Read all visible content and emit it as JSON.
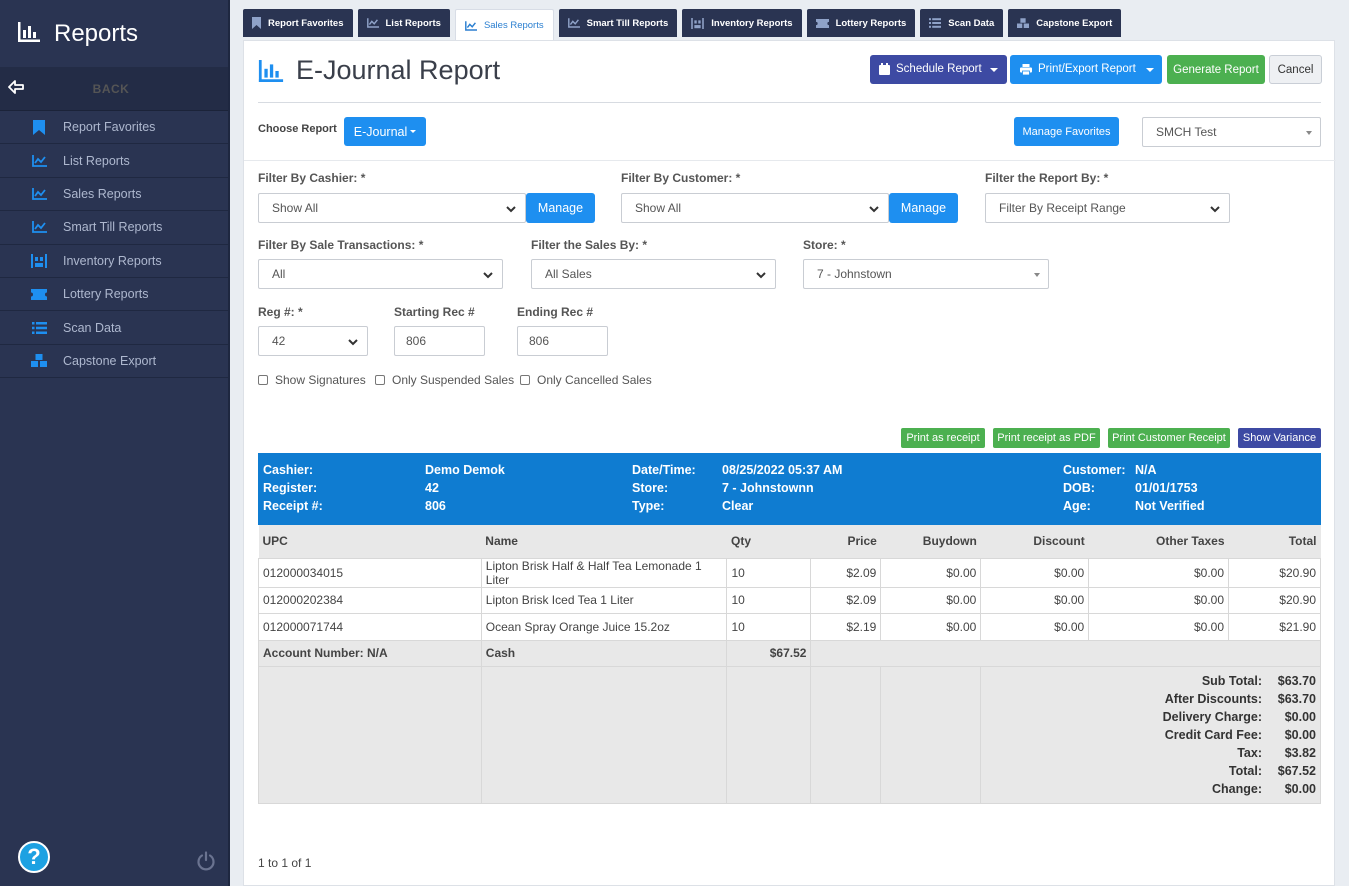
{
  "sidebar": {
    "title": "Reports",
    "back_label": "BACK",
    "items": [
      {
        "label": "Report Favorites"
      },
      {
        "label": "List Reports"
      },
      {
        "label": "Sales Reports"
      },
      {
        "label": "Smart Till Reports"
      },
      {
        "label": "Inventory Reports"
      },
      {
        "label": "Lottery Reports"
      },
      {
        "label": "Scan Data"
      },
      {
        "label": "Capstone Export"
      }
    ],
    "help_label": "?"
  },
  "tabs": [
    {
      "label": "Report Favorites"
    },
    {
      "label": "List Reports"
    },
    {
      "label": "Sales Reports",
      "active": true
    },
    {
      "label": "Smart Till Reports"
    },
    {
      "label": "Inventory Reports"
    },
    {
      "label": "Lottery Reports"
    },
    {
      "label": "Scan Data"
    },
    {
      "label": "Capstone Export"
    }
  ],
  "page": {
    "title": "E-Journal Report",
    "schedule_label": "Schedule Report",
    "print_label": "Print/Export Report",
    "generate_label": "Generate Report",
    "cancel_label": "Cancel",
    "choose_report_label": "Choose Report",
    "choose_report_value": "E-Journal",
    "manage_favorites_label": "Manage Favorites",
    "favorite_value": "SMCH Test"
  },
  "filters": {
    "cashier_label": "Filter By Cashier: *",
    "cashier_value": "Show All",
    "customer_label": "Filter By Customer: *",
    "customer_value": "Show All",
    "manage_label": "Manage",
    "report_by_label": "Filter the Report By: *",
    "report_by_value": "Filter By Receipt Range",
    "sale_trans_label": "Filter By Sale Transactions: *",
    "sale_trans_value": "All",
    "sales_by_label": "Filter the Sales By: *",
    "sales_by_value": "All Sales",
    "store_label": "Store: *",
    "store_value": "7 - Johnstown",
    "reg_label": "Reg #: *",
    "reg_value": "42",
    "start_label": "Starting Rec #",
    "start_value": "806",
    "end_label": "Ending Rec #",
    "end_value": "806",
    "show_signatures": "Show Signatures",
    "only_suspended": "Only Suspended Sales",
    "only_cancelled": "Only Cancelled Sales"
  },
  "actions": {
    "print_receipt": "Print as receipt",
    "print_pdf": "Print receipt as PDF",
    "print_customer": "Print Customer Receipt",
    "show_variance": "Show Variance"
  },
  "receipt": {
    "cashier_k": "Cashier:",
    "cashier_v": "Demo Demok",
    "register_k": "Register:",
    "register_v": "42",
    "receipt_k": "Receipt #:",
    "receipt_v": "806",
    "datetime_k": "Date/Time:",
    "datetime_v": "08/25/2022 05:37 AM",
    "store_k": "Store:",
    "store_v": "7 - Johnstownn",
    "type_k": "Type:",
    "type_v": "Clear",
    "customer_k": "Customer:",
    "customer_v": "N/A",
    "dob_k": "DOB:",
    "dob_v": "01/01/1753",
    "age_k": "Age:",
    "age_v": "Not Verified"
  },
  "table": {
    "headers": [
      "UPC",
      "Name",
      "Qty",
      "Price",
      "Buydown",
      "Discount",
      "Other Taxes",
      "Total"
    ],
    "rows": [
      [
        "012000034015",
        "Lipton Brisk Half & Half Tea Lemonade 1 Liter",
        "10",
        "$2.09",
        "$0.00",
        "$0.00",
        "$0.00",
        "$20.90"
      ],
      [
        "012000202384",
        "Lipton Brisk Iced Tea 1 Liter",
        "10",
        "$2.09",
        "$0.00",
        "$0.00",
        "$0.00",
        "$20.90"
      ],
      [
        "012000071744",
        "Ocean Spray Orange Juice 15.2oz",
        "10",
        "$2.19",
        "$0.00",
        "$0.00",
        "$0.00",
        "$21.90"
      ]
    ],
    "account_number": "Account Number: N/A",
    "payment_type": "Cash",
    "payment_amount": "$67.52",
    "totals": [
      {
        "k": "Sub Total:",
        "v": "$63.70"
      },
      {
        "k": "After Discounts:",
        "v": "$63.70"
      },
      {
        "k": "Delivery Charge:",
        "v": "$0.00"
      },
      {
        "k": "Credit Card Fee:",
        "v": "$0.00"
      },
      {
        "k": "Tax:",
        "v": "$3.82"
      },
      {
        "k": "Total:",
        "v": "$67.52"
      },
      {
        "k": "Change:",
        "v": "$0.00"
      }
    ]
  },
  "pager": "1 to 1 of 1",
  "colors": {
    "sidebar": "#2a3452",
    "accent_blue": "#1e8ff0",
    "navy_button": "#3d4aa3",
    "green": "#4cb050",
    "receipt_header": "#0f7cd1"
  }
}
